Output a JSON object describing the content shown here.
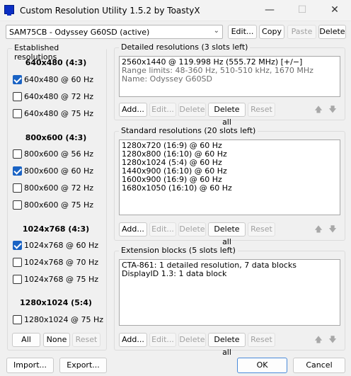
{
  "window": {
    "title": "Custom Resolution Utility 1.5.2 by ToastyX",
    "minimize": "—",
    "maximize": "☐",
    "close": "✕"
  },
  "monitor": {
    "selected": "SAM75CB - Odyssey G60SD (active)",
    "edit": "Edit...",
    "copy": "Copy",
    "paste": "Paste",
    "delete": "Delete"
  },
  "established": {
    "title": "Established resolutions",
    "groups": [
      {
        "heading": "640x480 (4:3)",
        "items": [
          {
            "label": "640x480 @ 60 Hz",
            "checked": true
          },
          {
            "label": "640x480 @ 72 Hz",
            "checked": false
          },
          {
            "label": "640x480 @ 75 Hz",
            "checked": false
          }
        ]
      },
      {
        "heading": "800x600 (4:3)",
        "items": [
          {
            "label": "800x600 @ 56 Hz",
            "checked": false
          },
          {
            "label": "800x600 @ 60 Hz",
            "checked": true
          },
          {
            "label": "800x600 @ 72 Hz",
            "checked": false
          },
          {
            "label": "800x600 @ 75 Hz",
            "checked": false
          }
        ]
      },
      {
        "heading": "1024x768 (4:3)",
        "items": [
          {
            "label": "1024x768 @ 60 Hz",
            "checked": true
          },
          {
            "label": "1024x768 @ 70 Hz",
            "checked": false
          },
          {
            "label": "1024x768 @ 75 Hz",
            "checked": false
          }
        ]
      },
      {
        "heading": "1280x1024 (5:4)",
        "items": [
          {
            "label": "1280x1024 @ 75 Hz",
            "checked": false
          }
        ]
      }
    ],
    "all": "All",
    "none": "None",
    "reset": "Reset"
  },
  "detailed": {
    "title": "Detailed resolutions (3 slots left)",
    "lines": [
      "2560x1440 @ 119.998 Hz (555.72 MHz) [+/−]",
      "Range limits: 48-360 Hz, 510-510 kHz, 1670 MHz",
      "Name: Odyssey G60SD"
    ]
  },
  "standard": {
    "title": "Standard resolutions (20 slots left)",
    "lines": [
      "1280x720 (16:9) @ 60 Hz",
      "1280x800 (16:10) @ 60 Hz",
      "1280x1024 (5:4) @ 60 Hz",
      "1440x900 (16:10) @ 60 Hz",
      "1600x900 (16:9) @ 60 Hz",
      "1680x1050 (16:10) @ 60 Hz"
    ]
  },
  "extension": {
    "title": "Extension blocks (5 slots left)",
    "lines": [
      "CTA-861: 1 detailed resolution, 7 data blocks",
      "DisplayID 1.3: 1 data block"
    ]
  },
  "list_buttons": {
    "add": "Add...",
    "edit": "Edit...",
    "delete": "Delete",
    "delete_all": "Delete all",
    "reset": "Reset",
    "up": "🡅",
    "down": "🡇"
  },
  "footer": {
    "import": "Import...",
    "export": "Export...",
    "ok": "OK",
    "cancel": "Cancel"
  },
  "colors": {
    "accent": "#1a63c4",
    "window_bg": "#f0f0f0"
  }
}
